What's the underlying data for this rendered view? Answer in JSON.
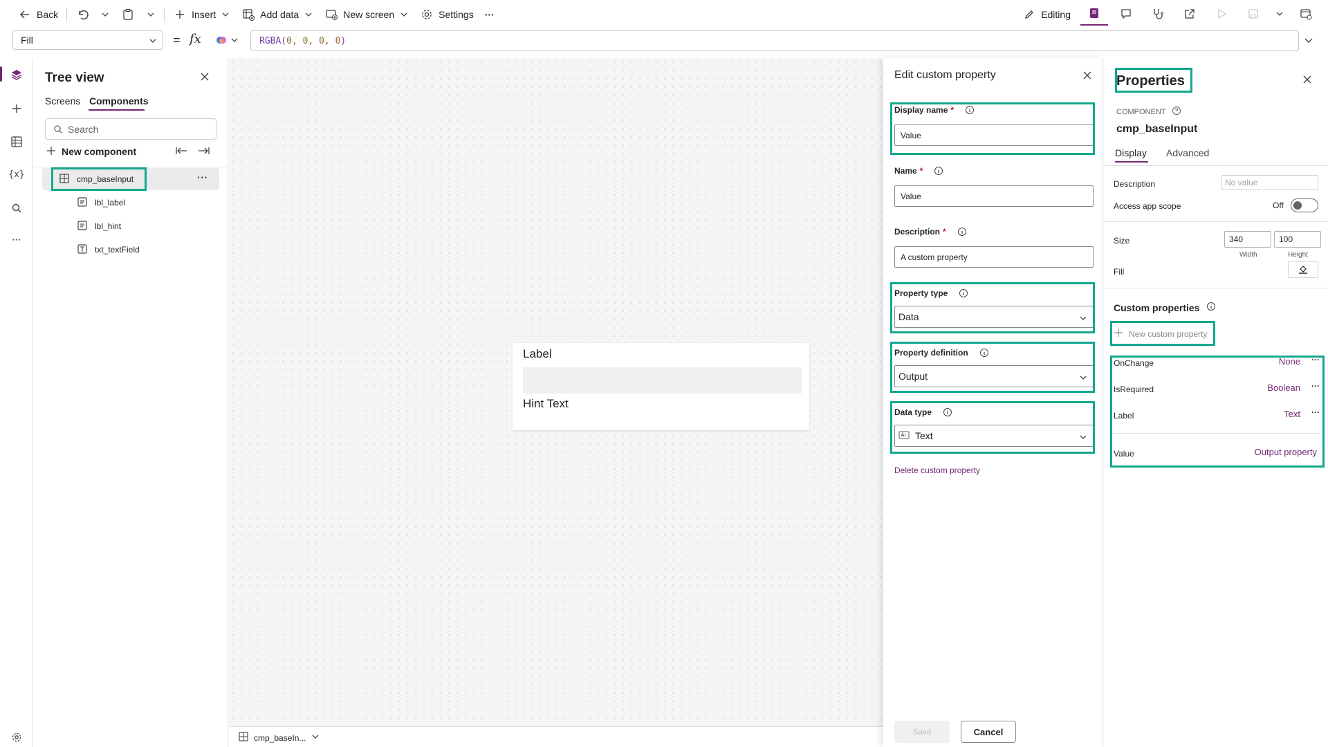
{
  "toolbar": {
    "back": "Back",
    "insert": "Insert",
    "add_data": "Add data",
    "new_screen": "New screen",
    "settings": "Settings",
    "more": "···",
    "editing": "Editing"
  },
  "formula_bar": {
    "property": "Fill",
    "equals": "=",
    "fx": "fx",
    "formula_fn": "RGBA(",
    "formula_args": "0, 0, 0, 0",
    "formula_close": ")"
  },
  "tree_view": {
    "title": "Tree view",
    "tabs": [
      "Screens",
      "Components"
    ],
    "search_placeholder": "Search",
    "new_component": "New component",
    "root": "cmp_baseInput",
    "children": [
      "lbl_label",
      "lbl_hint",
      "txt_textField"
    ],
    "more": "···"
  },
  "canvas": {
    "component_label": "Label",
    "component_hint": "Hint Text",
    "bottom_tab": "cmp_baseIn..."
  },
  "edit_panel": {
    "title": "Edit custom property",
    "display_name_label": "Display name",
    "display_name_value": "Value",
    "name_label": "Name",
    "name_value": "Value",
    "description_label": "Description",
    "description_value": "A custom property",
    "required_mark": "*",
    "property_type_label": "Property type",
    "property_type_value": "Data",
    "property_definition_label": "Property definition",
    "property_definition_value": "Output",
    "data_type_label": "Data type",
    "data_type_value": "Text",
    "delete_link": "Delete custom property",
    "save": "Save",
    "cancel": "Cancel"
  },
  "properties": {
    "title": "Properties",
    "caption": "COMPONENT",
    "component_name": "cmp_baseInput",
    "tabs": [
      "Display",
      "Advanced"
    ],
    "description_label": "Description",
    "description_placeholder": "No value",
    "access_scope_label": "Access app scope",
    "access_scope_value": "Off",
    "size_label": "Size",
    "width": "340",
    "height": "100",
    "width_caption": "Width",
    "height_caption": "Height",
    "fill_label": "Fill",
    "custom_properties_title": "Custom properties",
    "new_custom_property": "New custom property",
    "custom_properties": [
      {
        "name": "OnChange",
        "type": "None"
      },
      {
        "name": "IsRequired",
        "type": "Boolean"
      },
      {
        "name": "Label",
        "type": "Text"
      }
    ],
    "value_row": {
      "name": "Value",
      "type": "Output property"
    },
    "more": "···"
  },
  "colors": {
    "accent": "#742774",
    "highlight": "#12a88e"
  }
}
